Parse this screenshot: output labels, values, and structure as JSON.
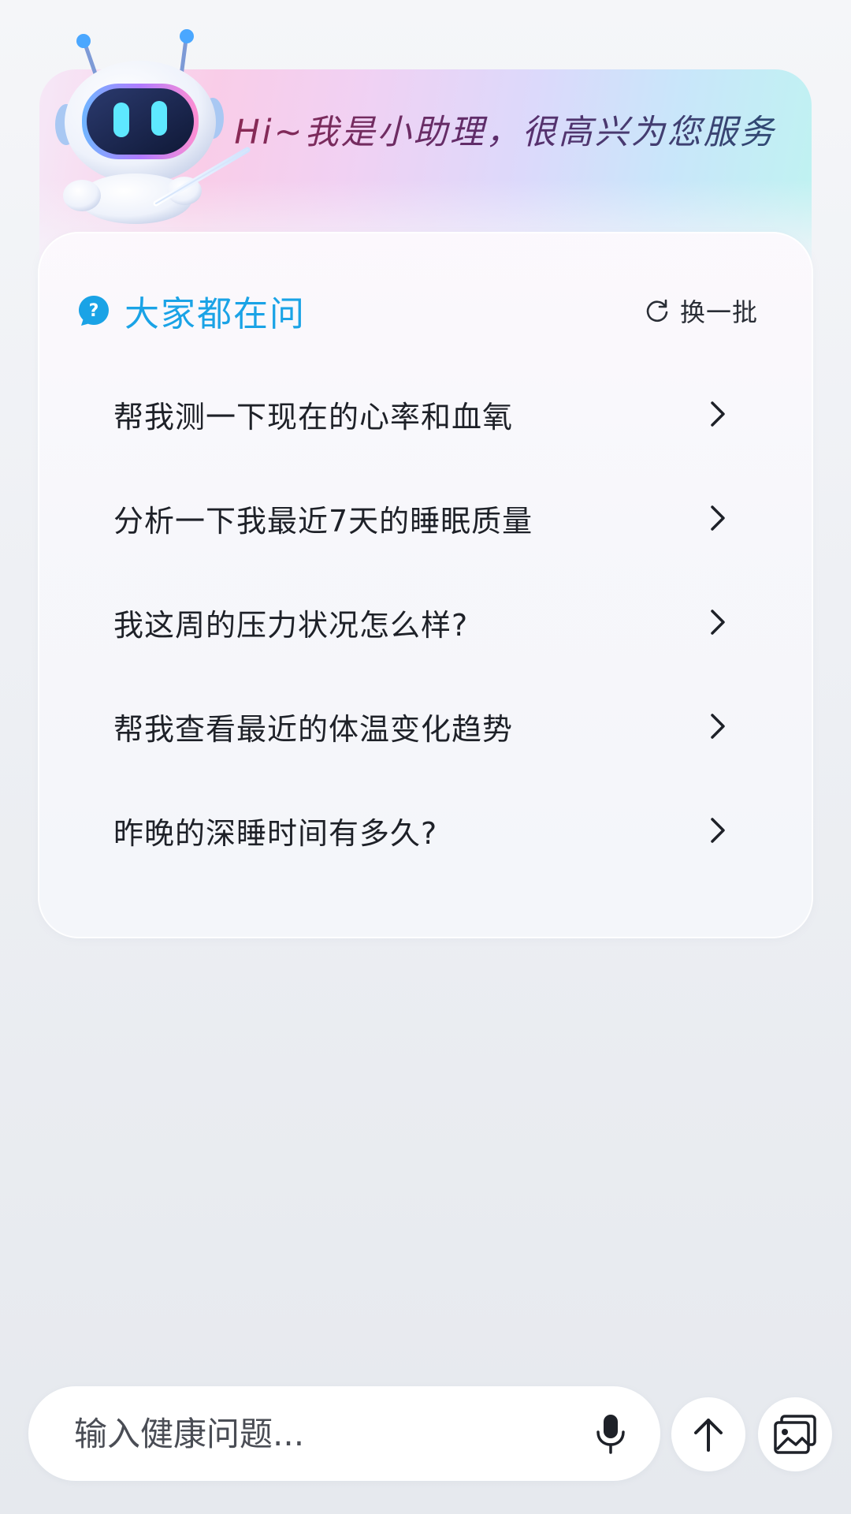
{
  "header": {
    "greeting": "Hi~我是小助理，很高兴为您服务"
  },
  "card": {
    "title": "大家都在问",
    "refresh_label": "换一批",
    "questions": [
      "帮我测一下现在的心率和血氧",
      "分析一下我最近7天的睡眠质量",
      "我这周的压力状况怎么样?",
      "帮我查看最近的体温变化趋势",
      "昨晚的深睡时间有多久?"
    ]
  },
  "input": {
    "placeholder": "输入健康问题...",
    "value": ""
  },
  "icons": {
    "title_icon": "question-bubble-icon",
    "refresh_icon": "refresh-icon",
    "item_icon": "chevron-right-icon",
    "mic_icon": "microphone-icon",
    "send_icon": "arrow-up-icon",
    "image_icon": "image-icon",
    "mascot": "robot-mascot"
  },
  "colors": {
    "accent": "#1aa3e6",
    "text": "#1e2128",
    "greeting_start": "#8a2a55",
    "greeting_end": "#2f4a74"
  }
}
